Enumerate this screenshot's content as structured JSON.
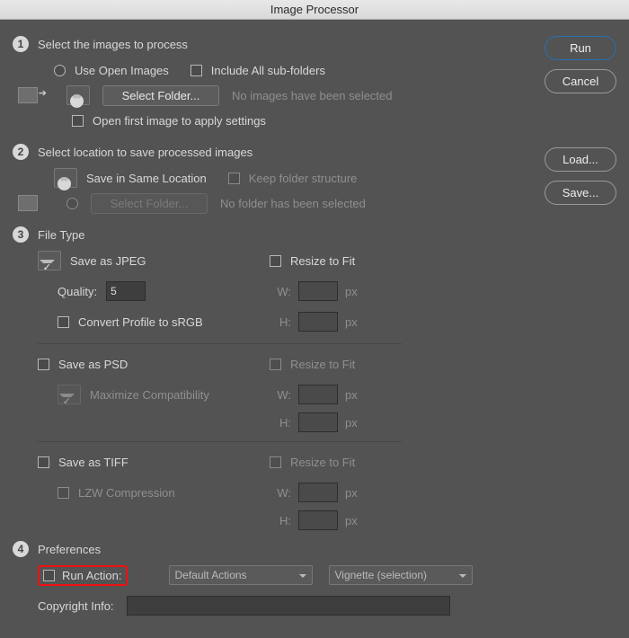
{
  "window": {
    "title": "Image Processor"
  },
  "buttons": {
    "run": "Run",
    "cancel": "Cancel",
    "load": "Load...",
    "save": "Save..."
  },
  "sec1": {
    "title": "Select the images to process",
    "use_open": "Use Open Images",
    "include_sub": "Include All sub-folders",
    "select_folder": "Select Folder...",
    "no_sel": "No images have been selected",
    "open_first": "Open first image to apply settings"
  },
  "sec2": {
    "title": "Select location to save processed images",
    "same_loc": "Save in Same Location",
    "keep_struct": "Keep folder structure",
    "select_folder": "Select Folder...",
    "no_sel": "No folder has been selected"
  },
  "sec3": {
    "title": "File Type",
    "jpeg": {
      "label": "Save as JPEG",
      "quality_lbl": "Quality:",
      "quality_val": "5",
      "srgb": "Convert Profile to sRGB",
      "resize": "Resize to Fit",
      "w": "W:",
      "h": "H:",
      "px": "px"
    },
    "psd": {
      "label": "Save as PSD",
      "maxcompat": "Maximize Compatibility",
      "resize": "Resize to Fit",
      "w": "W:",
      "h": "H:",
      "px": "px"
    },
    "tiff": {
      "label": "Save as TIFF",
      "lzw": "LZW Compression",
      "resize": "Resize to Fit",
      "w": "W:",
      "h": "H:",
      "px": "px"
    }
  },
  "sec4": {
    "title": "Preferences",
    "run_action": "Run Action:",
    "action_set": "Default Actions",
    "action_name": "Vignette (selection)",
    "copyright": "Copyright Info:"
  }
}
